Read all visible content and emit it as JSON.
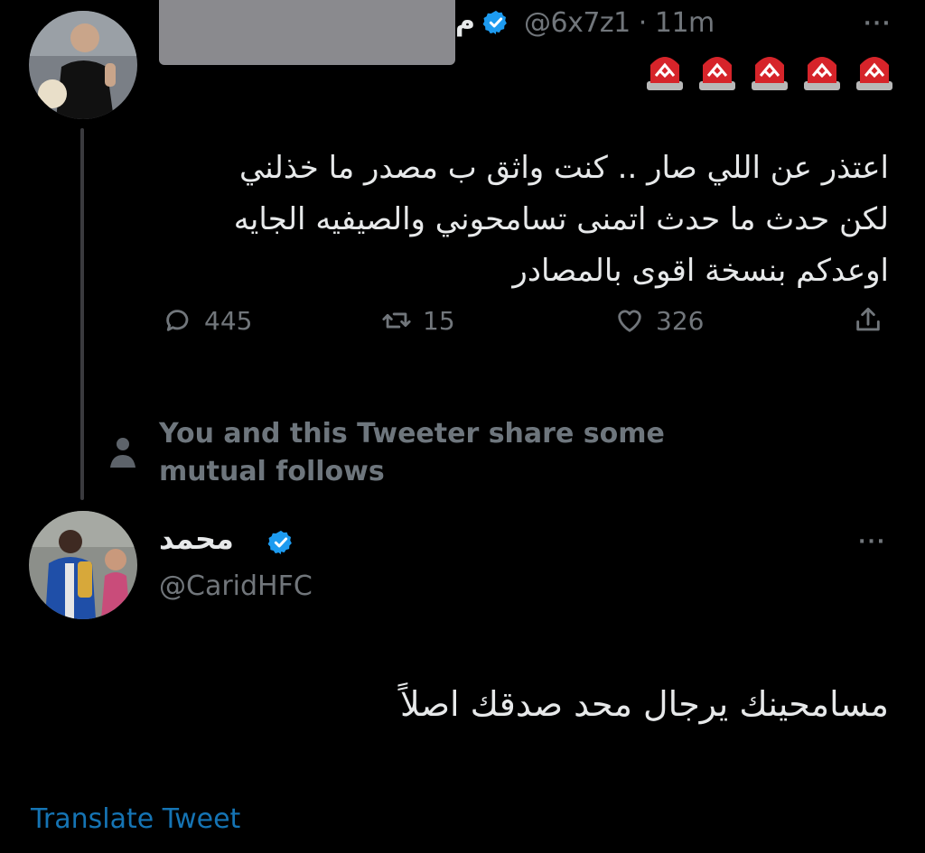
{
  "tweet": {
    "handle_time": "@6x7z1 · 11m",
    "name_fragment": "م",
    "name_redacted": true,
    "more_label": "···",
    "emoji": [
      "police-siren",
      "police-siren",
      "police-siren",
      "police-siren",
      "police-siren"
    ],
    "text_lines": [
      "اعتذر عن اللي صار .. كنت واثق ب مصدر ما خذلني",
      "لكن حدث ما حدث اتمنى تسامحوني والصيفيه الجايه",
      "اوعدكم بنسخة اقوى بالمصادر"
    ],
    "actions": {
      "reply_count": "445",
      "retweet_count": "15",
      "like_count": "326"
    }
  },
  "mutual": {
    "line1": "You and this Tweeter share some",
    "line2": "mutual follows"
  },
  "reply": {
    "name": "محمد",
    "handle": "@CaridHFC",
    "more_label": "···",
    "text": "مسامحينك يرجال محد صدقك اصلاً",
    "translate_label": "Translate Tweet"
  },
  "colors": {
    "background": "#000000",
    "text_primary": "#e7e9ea",
    "text_secondary": "#71767b",
    "accent": "#1d9bf0",
    "verified": "#1d9bf0"
  }
}
